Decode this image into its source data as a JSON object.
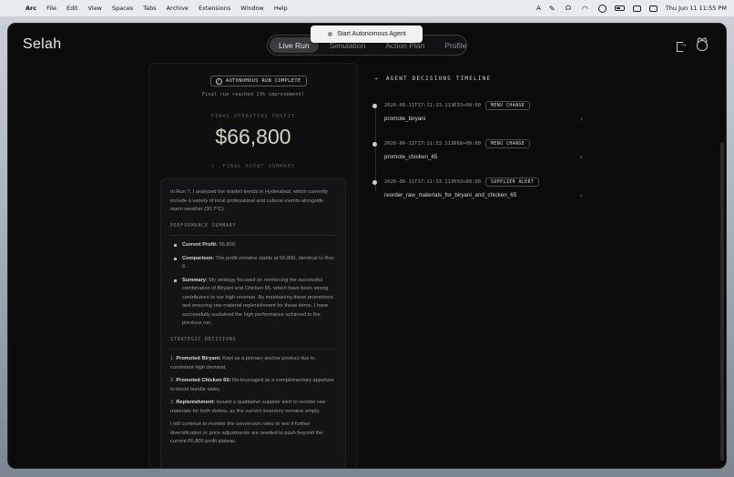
{
  "menubar": {
    "app": "Arc",
    "items": [
      "File",
      "Edit",
      "View",
      "Spaces",
      "Tabs",
      "Archive",
      "Extensions",
      "Window",
      "Help"
    ],
    "datetime": "Thu Jun 11  11:55 PM"
  },
  "app": {
    "brand": "Selah",
    "tabs": [
      "Live Run",
      "Simulation",
      "Action Plan",
      "Profile"
    ],
    "active_tab": "Live Run",
    "tooltip": "Start Autonomous Agent"
  },
  "run": {
    "badge": "AUTONOMOUS RUN COMPLETE",
    "subtitle": "Final run reached 13% improvement!",
    "profit_label": "FINAL OPERATING PROFIT",
    "profit_value": "$66,800",
    "summary_label": "FINAL AGENT SUMMARY",
    "summary_label_icon": "x-icon"
  },
  "summary": {
    "intro": "In Run 7, I analyzed the market trends in Hyderabad, which currently include a variety of local professional and cultural events alongside warm weather (30.7°C).",
    "perf_heading": "PERFORMANCE SUMMARY",
    "perf": [
      {
        "label": "Current Profit:",
        "text": " 66,800."
      },
      {
        "label": "Comparison:",
        "text": " The profit remains stable at 66,800, identical to Run 6."
      },
      {
        "label": "Summary:",
        "text": " My strategy focused on reinforcing the successful combination of Biryani and Chicken 65, which have been strong contributors to our high revenue. By maintaining these promotions and ensuring raw material replenishment for these items, I have successfully sustained the high performance achieved in the previous run."
      }
    ],
    "strat_heading": "STRATEGIC DECISIONS",
    "strat": [
      {
        "prefix": "1. ",
        "label": "Promoted Biryani:",
        "text": " Kept as a primary anchor product due to consistent high demand."
      },
      {
        "prefix": "2. ",
        "label": "Promoted Chicken 65:",
        "text": " Re-leveraged as a complementary appetizer to boost bundle sales."
      },
      {
        "prefix": "3. ",
        "label": "Replenishment:",
        "text": " Issued a qualitative supplier alert to reorder raw materials for both dishes, as the current inventory remains empty."
      }
    ],
    "closing": "I will continue to monitor the conversion rates to see if further diversification or price adjustments are needed to push beyond the current 66,800 profit plateau."
  },
  "timeline": {
    "title": "AGENT DECISIONS TIMELINE",
    "entries": [
      {
        "timestamp": "2026-06-11T17:11:33.113633+00:00",
        "tag": "MENU CHANGE",
        "name": "promote_biryani"
      },
      {
        "timestamp": "2026-06-11T17:11:33.113668+00:00",
        "tag": "MENU CHANGE",
        "name": "promote_chicken_65"
      },
      {
        "timestamp": "2026-06-11T17:11:33.113693+00:00",
        "tag": "SUPPLIER ALERT",
        "name": "reorder_raw_materials_for_biryani_and_chicken_65"
      }
    ]
  }
}
